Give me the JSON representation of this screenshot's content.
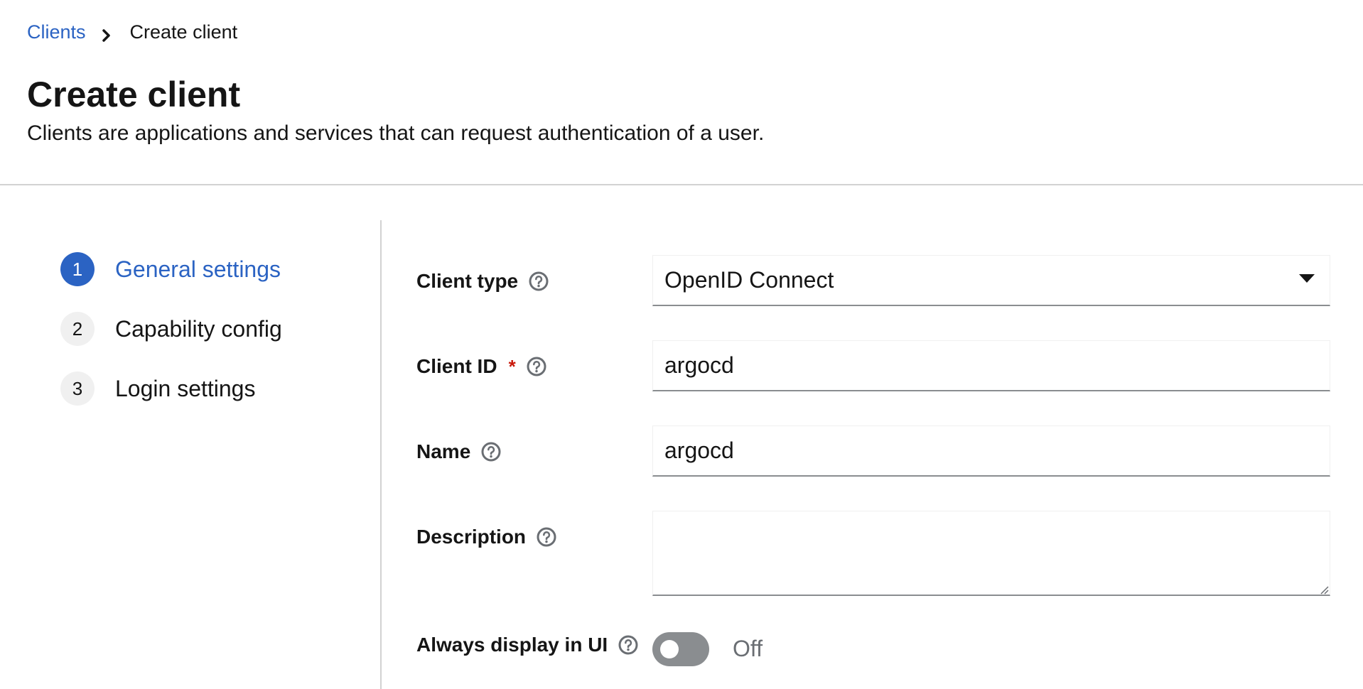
{
  "breadcrumb": {
    "parent": "Clients",
    "current": "Create client"
  },
  "page": {
    "title": "Create client",
    "description": "Clients are applications and services that can request authentication of a user."
  },
  "wizard": {
    "steps": [
      {
        "number": "1",
        "label": "General settings",
        "active": true
      },
      {
        "number": "2",
        "label": "Capability config",
        "active": false
      },
      {
        "number": "3",
        "label": "Login settings",
        "active": false
      }
    ]
  },
  "form": {
    "client_type": {
      "label": "Client type",
      "value": "OpenID Connect"
    },
    "client_id": {
      "label": "Client ID",
      "required_mark": "*",
      "value": "argocd"
    },
    "name": {
      "label": "Name",
      "value": "argocd"
    },
    "description": {
      "label": "Description",
      "value": ""
    },
    "always_display": {
      "label": "Always display in UI",
      "state": "Off"
    }
  },
  "colors": {
    "accent": "#2b63c3",
    "required": "#c9190b",
    "toggle_off": "#8a8d90"
  },
  "icons": {
    "help": "question-circle-icon",
    "breadcrumb_sep": "chevron-right-icon",
    "select_caret": "caret-down-icon"
  }
}
